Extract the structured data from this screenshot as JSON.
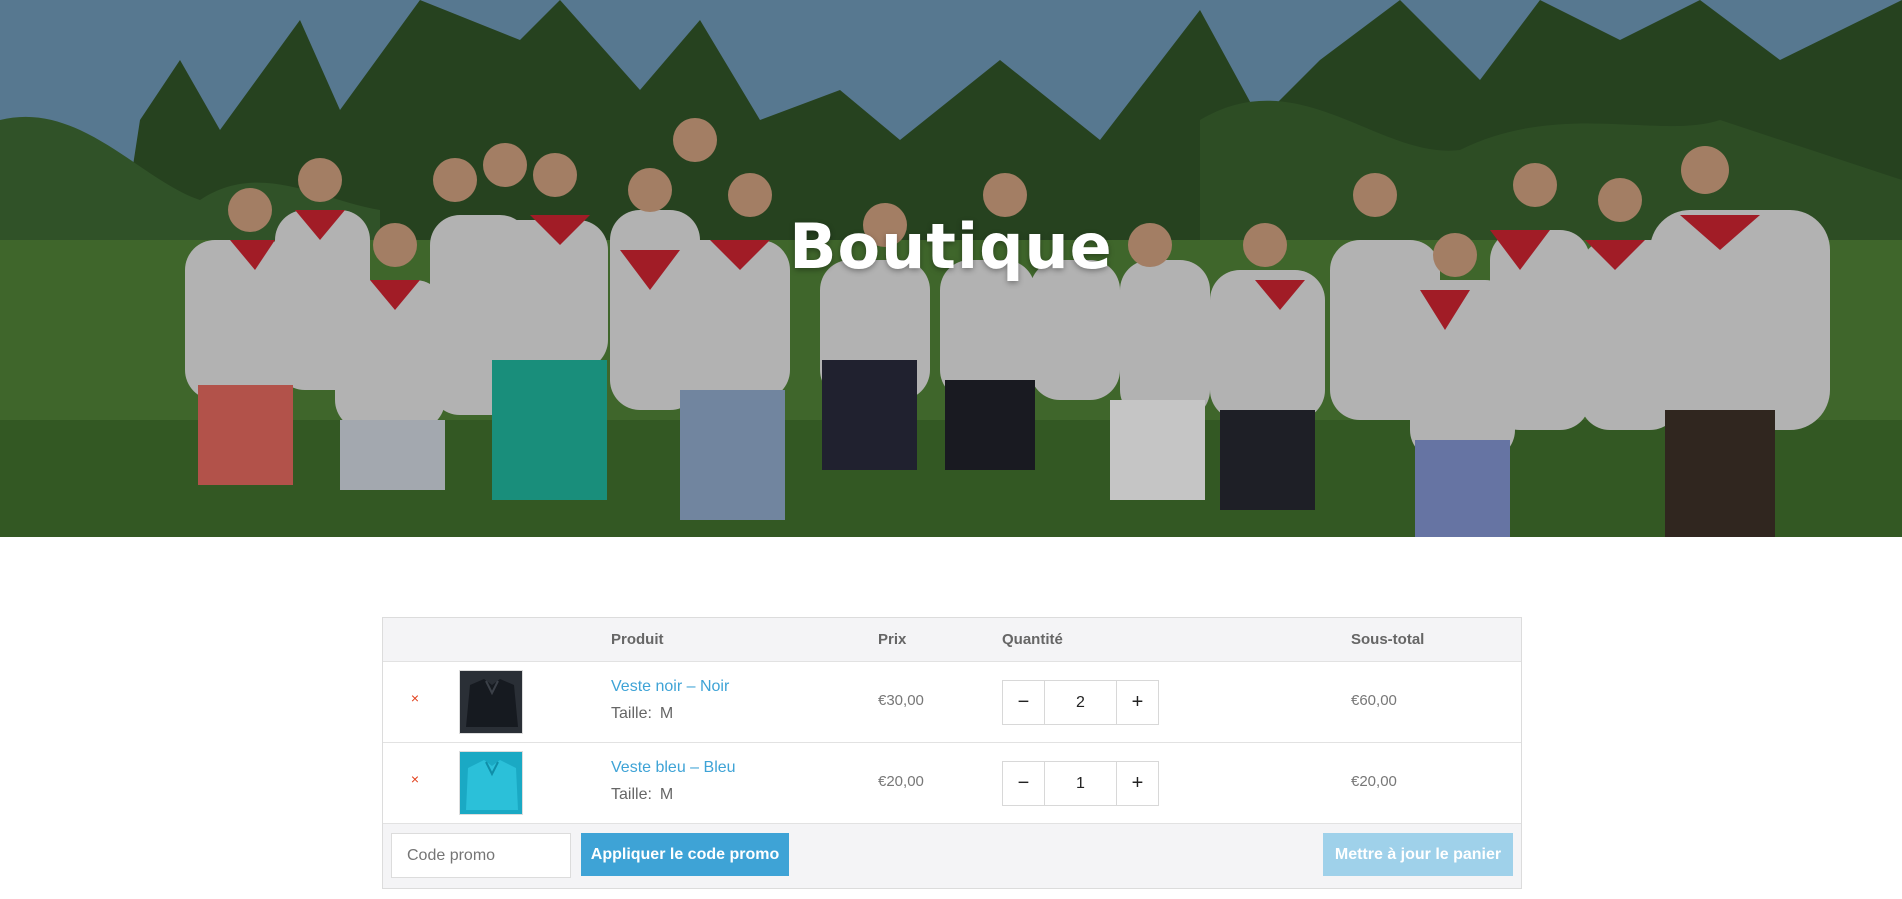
{
  "hero": {
    "title": "Boutique"
  },
  "cart": {
    "headers": {
      "product": "Produit",
      "price": "Prix",
      "quantity": "Quantité",
      "subtotal": "Sous-total"
    },
    "items": [
      {
        "remove": "×",
        "name": "Veste noir – Noir",
        "attr_label": "Taille:",
        "attr_value": "M",
        "price": "€30,00",
        "quantity": "2",
        "subtotal": "€60,00",
        "thumb_color": "#1c2229"
      },
      {
        "remove": "×",
        "name": "Veste bleu – Bleu",
        "attr_label": "Taille:",
        "attr_value": "M",
        "price": "€20,00",
        "quantity": "1",
        "subtotal": "€20,00",
        "thumb_color": "#22b7cf"
      }
    ],
    "qty_minus": "−",
    "qty_plus": "+",
    "coupon_placeholder": "Code promo",
    "apply_label": "Appliquer le code promo",
    "update_label": "Mettre à jour le panier"
  },
  "colors": {
    "accent": "#3ea3d6",
    "accent_disabled": "#9fd1ea",
    "remove": "#e2401c"
  }
}
